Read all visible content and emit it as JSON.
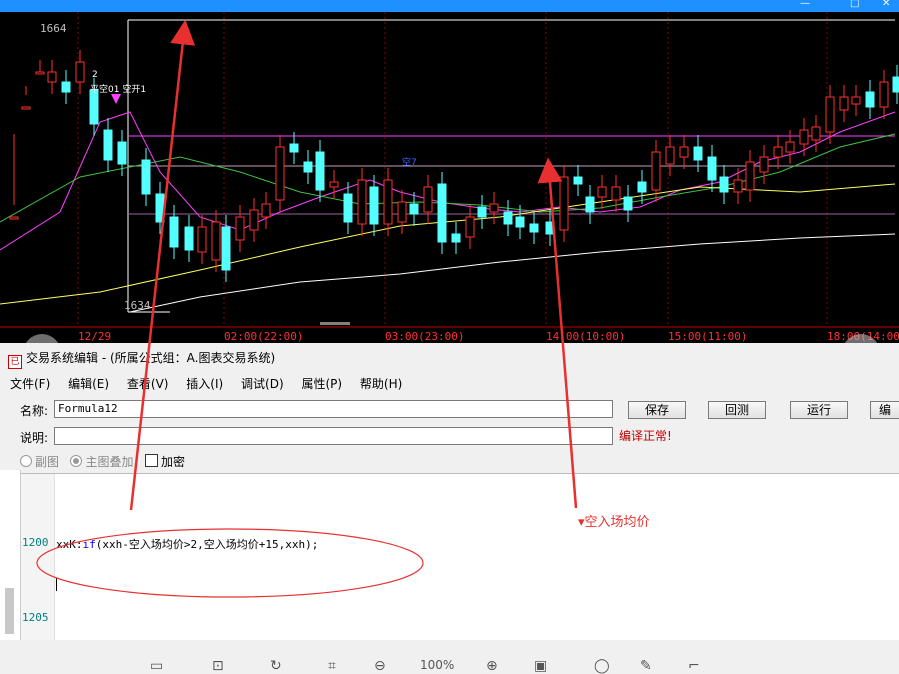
{
  "window": {
    "title": "交易系统编辑 - (所属公式组：A.图表交易系统)",
    "app_icon_glyph": "已",
    "controls": [
      "—",
      "□",
      "✕"
    ]
  },
  "chart": {
    "price_high": "1664",
    "price_low": "1634",
    "signal_label": "平空01 空开1",
    "signal_count": "2",
    "mid_label": "空7",
    "time_labels": [
      "12/29",
      "02:00(22:00)",
      "03:00(23:00)",
      "14:00(10:00)",
      "15:00(11:00)",
      "18:00(14:00)"
    ],
    "colors": {
      "background": "#000000",
      "up_candle": "#ff3030",
      "down_candle": "#54ffff",
      "ma_pink": "#ff40ff",
      "ma_green": "#40c040",
      "ma_yellow": "#ffff60",
      "ma_white": "#ffffff",
      "level_line": "#ff40ff"
    }
  },
  "nav": {
    "prev": "‹",
    "next": "›"
  },
  "menu": [
    "文件(F)",
    "编辑(E)",
    "查看(V)",
    "插入(I)",
    "调试(D)",
    "属性(P)",
    "帮助(H)"
  ],
  "form": {
    "name_label": "名称:",
    "name_value": "Formula12",
    "desc_label": "说明:",
    "desc_value": "",
    "status": "编译正常!"
  },
  "buttons": {
    "save": "保存",
    "test": "回测",
    "run": "运行",
    "edit": "编"
  },
  "options": {
    "subchart": "副图",
    "main_overlay": "主图叠加",
    "encrypt": "加密"
  },
  "code": {
    "line_numbers": [
      "1200",
      "1205"
    ],
    "text_prefix": "xxK:",
    "text_keyword": "if",
    "text_rest": "(xxh-空入场均价>2,空入场均价+15,xxh);"
  },
  "annotation": {
    "label": "空入场均价",
    "color": "#e83030"
  },
  "toolbar_icons": [
    "window-icon",
    "fit-icon",
    "rotate-icon",
    "crop-icon",
    "zoom-out-icon",
    "zoom-level",
    "zoom-in-icon",
    "original-size-icon",
    "annotate-icon",
    "edit-icon",
    "crop-tool-icon"
  ],
  "zoom_level": "100%"
}
